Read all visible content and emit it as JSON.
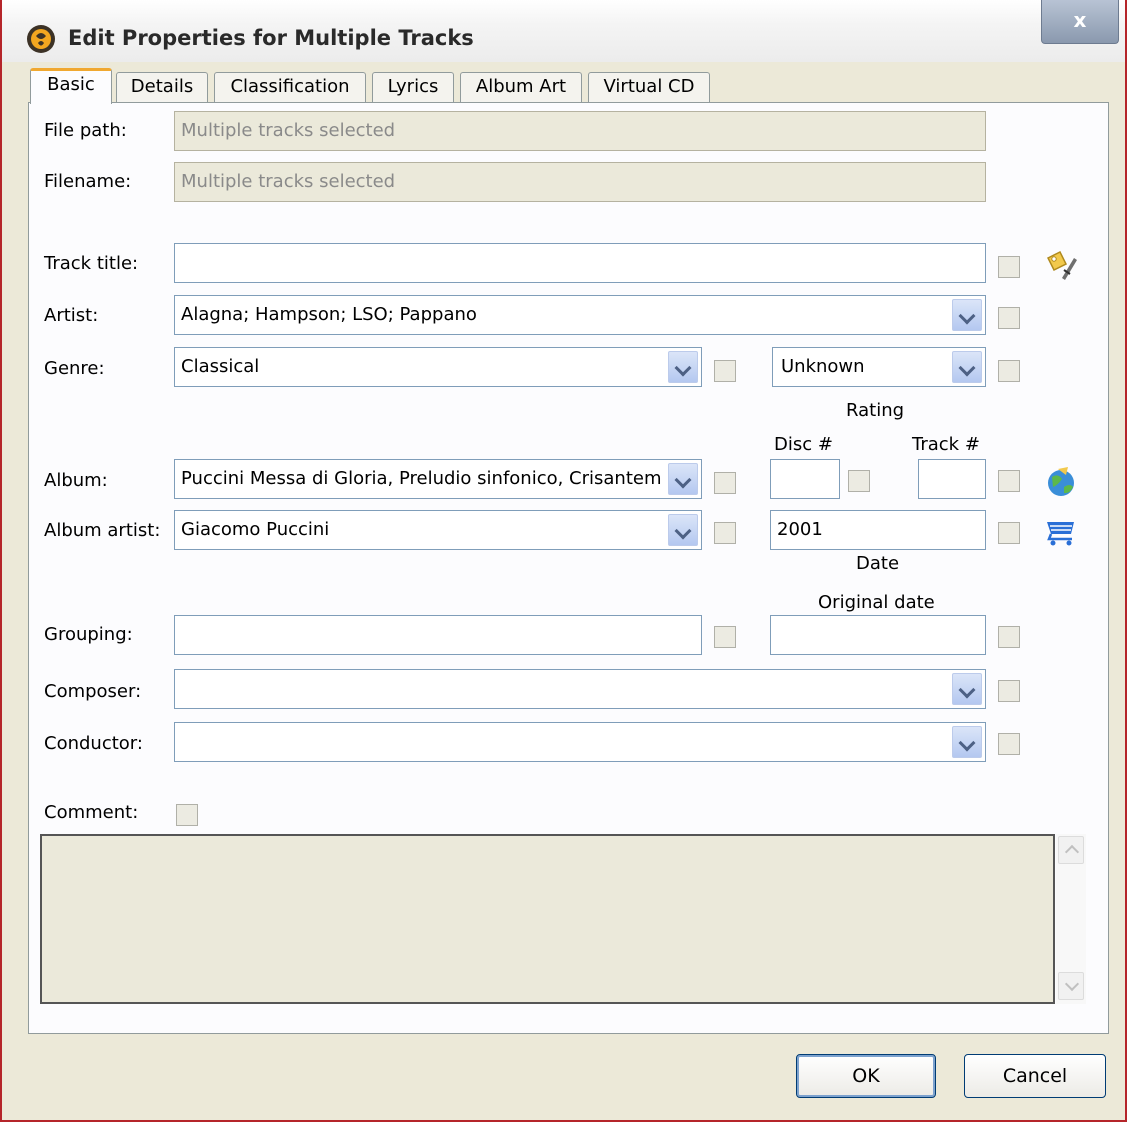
{
  "window": {
    "title": "Edit Properties for Multiple Tracks",
    "close_label": "x"
  },
  "tabs": [
    "Basic",
    "Details",
    "Classification",
    "Lyrics",
    "Album Art",
    "Virtual CD"
  ],
  "labels": {
    "file_path": "File path:",
    "filename": "Filename:",
    "track_title": "Track title:",
    "artist": "Artist:",
    "genre": "Genre:",
    "rating": "Rating",
    "disc": "Disc #",
    "track": "Track #",
    "album": "Album:",
    "album_artist": "Album artist:",
    "date": "Date",
    "original_date": "Original date",
    "grouping": "Grouping:",
    "composer": "Composer:",
    "conductor": "Conductor:",
    "comment": "Comment:"
  },
  "fields": {
    "file_path": "Multiple tracks selected",
    "filename": "Multiple tracks selected",
    "track_title": "",
    "artist": "Alagna; Hampson; LSO; Pappano",
    "genre": "Classical",
    "rating": "Unknown",
    "album": "Puccini Messa di Gloria, Preludio sinfonico, Crisantem",
    "disc": "",
    "track": "",
    "album_artist": "Giacomo Puccini",
    "date": "2001",
    "grouping": "",
    "original_date": "",
    "composer": "",
    "conductor": "",
    "comment": ""
  },
  "buttons": {
    "ok": "OK",
    "cancel": "Cancel"
  }
}
